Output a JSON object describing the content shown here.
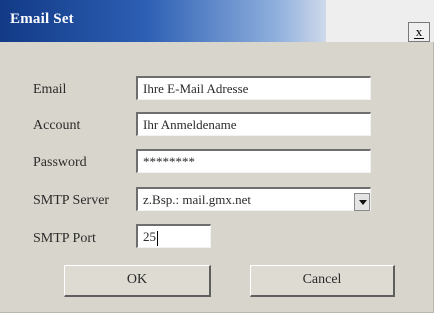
{
  "window": {
    "title": "Email Set",
    "close_glyph": "x"
  },
  "form": {
    "email_label": "Email",
    "email_value": "Ihre E-Mail Adresse",
    "account_label": "Account",
    "account_value": "Ihr Anmeldename",
    "password_label": "Password",
    "password_value": "********",
    "smtp_server_label": "SMTP Server",
    "smtp_server_value": "z.Bsp.: mail.gmx.net",
    "smtp_port_label": "SMTP Port",
    "smtp_port_value": "25"
  },
  "buttons": {
    "ok_label": "OK",
    "cancel_label": "Cancel"
  },
  "icons": {
    "close": "close-icon",
    "dropdown": "chevron-down-icon"
  },
  "colors": {
    "titlebar_dark": "#123a86",
    "titlebar_light": "#cfd9ea",
    "dialog_background": "#d8d5cc"
  }
}
